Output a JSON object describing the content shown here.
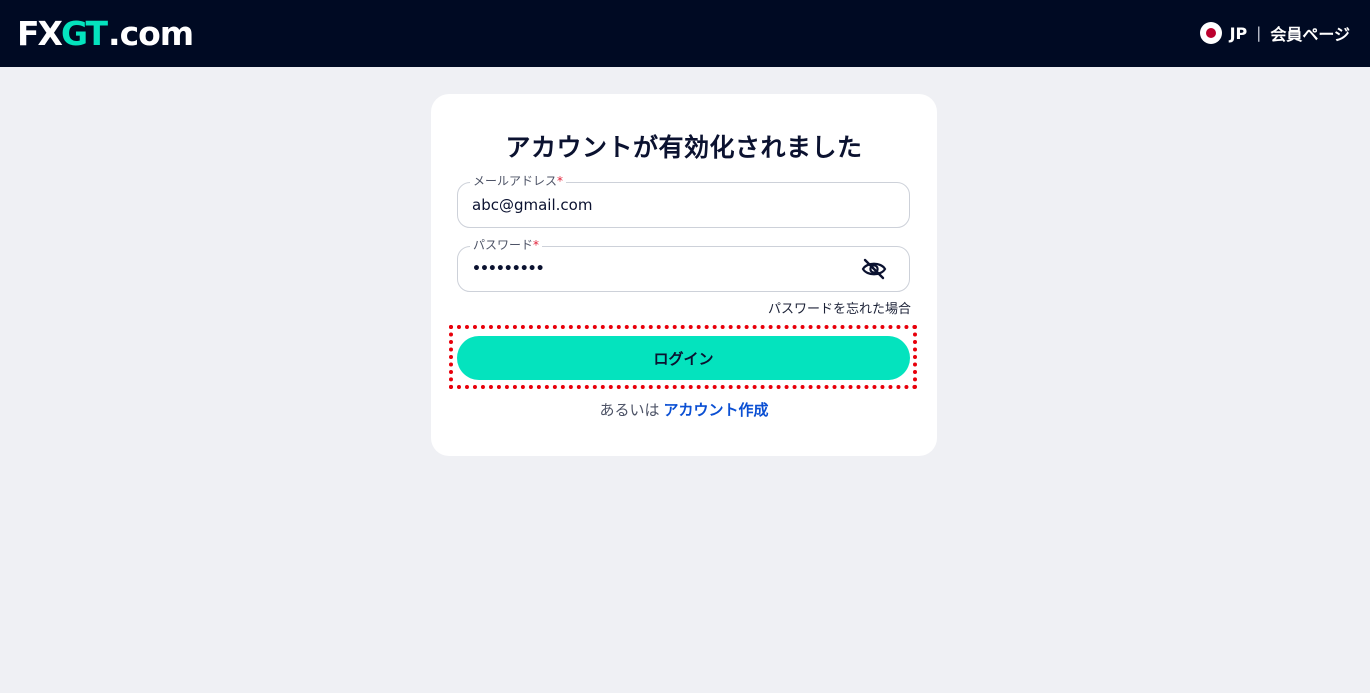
{
  "header": {
    "logo": {
      "part1": "FX",
      "part2": "GT",
      "part3": ".com"
    },
    "language": "JP",
    "separator": "|",
    "member_page_link": "会員ページ"
  },
  "card": {
    "title": "アカウントが有効化されました",
    "email": {
      "label": "メールアドレス",
      "required_mark": "*",
      "value": "abc@gmail.com"
    },
    "password": {
      "label": "パスワード",
      "required_mark": "*",
      "value": "•••••••••",
      "toggle_icon": "eye-off-icon"
    },
    "forgot_password": "パスワードを忘れた場合",
    "login_button": "ログイン",
    "alt_prefix": "あるいは",
    "create_account_link": "アカウント作成"
  },
  "colors": {
    "header_bg": "#000a23",
    "accent": "#04e3be",
    "link": "#0a4fd3",
    "highlight": "#e8000b",
    "page_bg": "#eff0f4"
  }
}
